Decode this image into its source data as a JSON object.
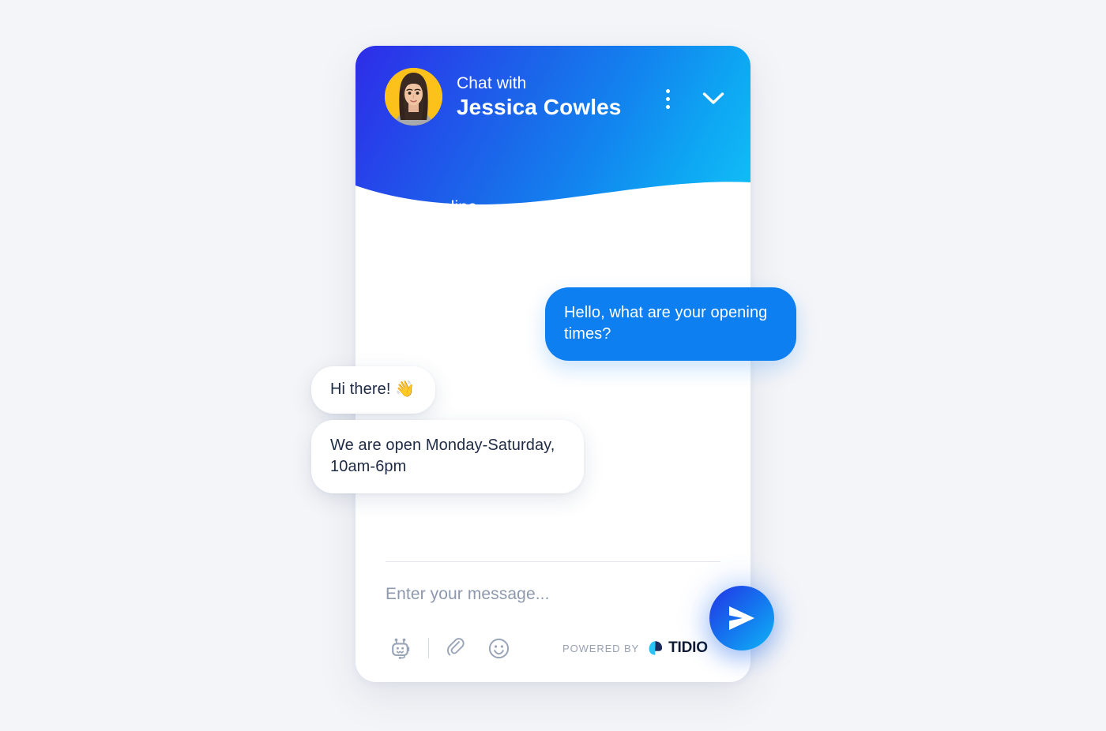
{
  "background_color": "#f4f5f8",
  "widget": {
    "accent_color": "#0d7ff0",
    "header": {
      "gradient_from": "#2e2ce8",
      "gradient_to": "#12c0f7",
      "chat_with_label": "Chat with",
      "agent_name": "Jessica Cowles",
      "status_text": "We're online",
      "avatar_background": "#fcc21b",
      "avatar_name": "avatar",
      "menu_icon": "three-dots-vertical-icon",
      "minimize_icon": "chevron-down-icon"
    },
    "messages": [
      {
        "author": "visitor",
        "text": "Hello, what are your opening times?"
      },
      {
        "author": "operator",
        "text": "Hi there! ",
        "emoji": "👋"
      },
      {
        "author": "operator",
        "text": "We are open Monday-Saturday, 10am-6pm"
      }
    ],
    "composer": {
      "placeholder": "Enter your message...",
      "value": "",
      "tools": [
        {
          "name": "chatbot-icon",
          "label": "Chatbot"
        },
        {
          "name": "attachment-icon",
          "label": "Attach file"
        },
        {
          "name": "emoji-icon",
          "label": "Emoji"
        }
      ],
      "send_icon": "send-icon",
      "send_label": "Send"
    },
    "footer": {
      "powered_by_label": "POWERED BY",
      "brand_name": "TIDIO",
      "brand_logo_icon": "tidio-logo-icon",
      "brand_color_dark": "#1a2b5c",
      "brand_color_light": "#29c3f7"
    }
  }
}
